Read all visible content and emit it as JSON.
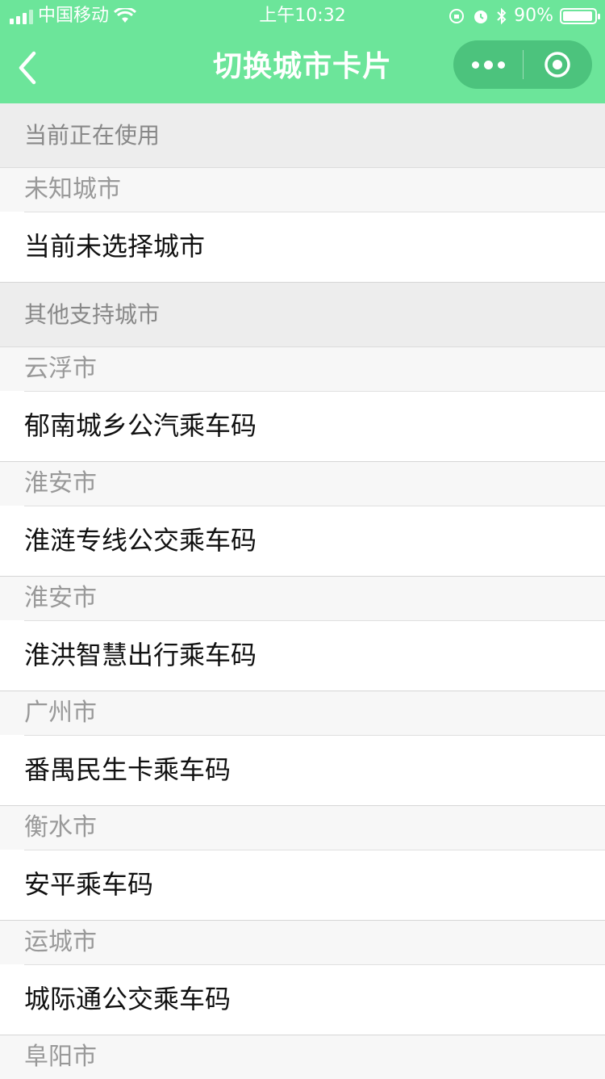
{
  "status_bar": {
    "carrier": "中国移动",
    "time": "上午10:32",
    "battery": "90%",
    "battery_level": 0.9
  },
  "nav": {
    "title": "切换城市卡片",
    "back_icon": "chevron-left-icon",
    "more_icon": "more-dots-icon",
    "close_icon": "target-circle-icon"
  },
  "current": {
    "header": "当前正在使用",
    "city": "未知城市",
    "card": "当前未选择城市"
  },
  "others": {
    "header": "其他支持城市",
    "items": [
      {
        "city": "云浮市",
        "card": "郁南城乡公汽乘车码"
      },
      {
        "city": "淮安市",
        "card": "淮涟专线公交乘车码"
      },
      {
        "city": "淮安市",
        "card": "淮洪智慧出行乘车码"
      },
      {
        "city": "广州市",
        "card": "番禺民生卡乘车码"
      },
      {
        "city": "衡水市",
        "card": "安平乘车码"
      },
      {
        "city": "运城市",
        "card": "城际通公交乘车码"
      },
      {
        "city": "阜阳市",
        "card": ""
      }
    ]
  },
  "colors": {
    "accent": "#6ce59a",
    "capsule": "#4cc37d"
  }
}
